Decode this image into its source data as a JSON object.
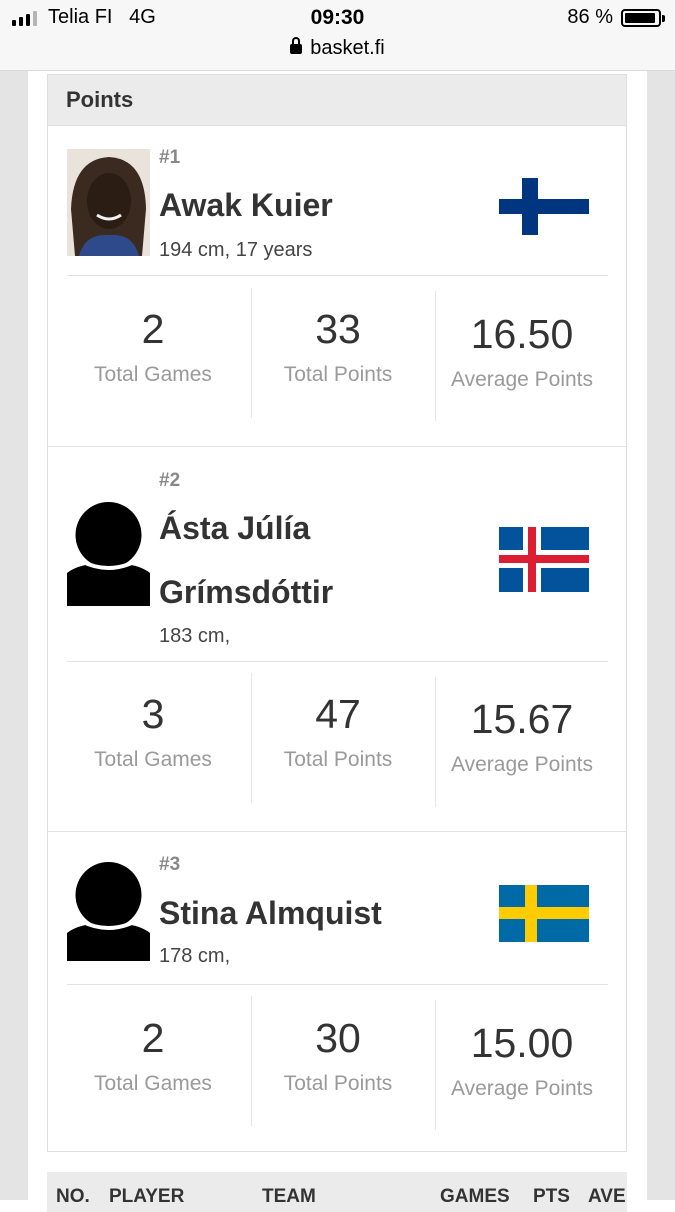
{
  "status_bar": {
    "carrier": "Telia FI",
    "network": "4G",
    "time": "09:30",
    "battery": "86 %",
    "battery_level": 0.86,
    "signal_bars": 4,
    "signal_filled": 3
  },
  "browser": {
    "url": "basket.fi"
  },
  "section": {
    "title": "Points"
  },
  "players": [
    {
      "rank": "#1",
      "name": "Awak Kuier",
      "meta": "194 cm, 17 years",
      "photo": "player-photo",
      "flag": "finland-flag",
      "stats": [
        {
          "value": "2",
          "label": "Total Games"
        },
        {
          "value": "33",
          "label": "Total Points"
        },
        {
          "value": "16.50",
          "label": "Average Points"
        }
      ]
    },
    {
      "rank": "#2",
      "name": "Ásta Júlía Grímsdóttir",
      "meta": "183 cm,",
      "photo": "avatar-placeholder-icon",
      "flag": "iceland-flag",
      "stats": [
        {
          "value": "3",
          "label": "Total Games"
        },
        {
          "value": "47",
          "label": "Total Points"
        },
        {
          "value": "15.67",
          "label": "Average Points"
        }
      ]
    },
    {
      "rank": "#3",
      "name": "Stina Almquist",
      "meta": "178 cm,",
      "photo": "avatar-placeholder-icon",
      "flag": "sweden-flag",
      "stats": [
        {
          "value": "2",
          "label": "Total Games"
        },
        {
          "value": "30",
          "label": "Total Points"
        },
        {
          "value": "15.00",
          "label": "Average Points"
        }
      ]
    }
  ],
  "table_header": {
    "columns": [
      "NO.",
      "PLAYER",
      "TEAM",
      "GAMES",
      "PTS",
      "AVE"
    ]
  },
  "colors": {
    "finland_blue": "#003580",
    "iceland_blue": "#02529C",
    "iceland_red": "#DC1E35",
    "sweden_blue": "#006AA7",
    "sweden_yellow": "#FECC00"
  }
}
